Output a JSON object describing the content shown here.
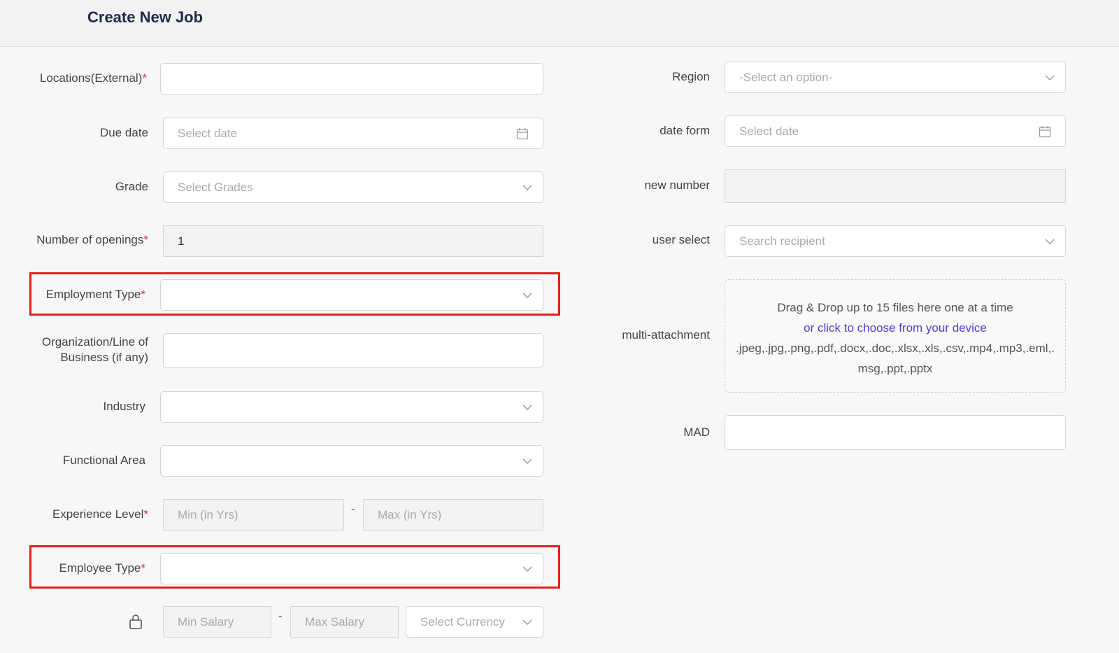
{
  "header": {
    "title": "Create New Job"
  },
  "left": {
    "locations": {
      "label": "Locations(External)",
      "required": "*",
      "value": ""
    },
    "due_date": {
      "label": "Due date",
      "placeholder": "Select date"
    },
    "grade": {
      "label": "Grade",
      "placeholder": "Select Grades"
    },
    "openings": {
      "label": "Number of openings",
      "required": "*",
      "value": "1"
    },
    "employment_type": {
      "label": "Employment Type",
      "required": "*",
      "value": ""
    },
    "organization": {
      "label_line1": "Organization/Line of",
      "label_line2": "Business (if any)",
      "value": ""
    },
    "industry": {
      "label": "Industry",
      "value": ""
    },
    "functional_area": {
      "label": "Functional Area",
      "value": ""
    },
    "experience": {
      "label": "Experience Level",
      "required": "*",
      "min_placeholder": "Min (in Yrs)",
      "max_placeholder": "Max (in Yrs)",
      "separator": "-"
    },
    "employee_type": {
      "label": "Employee Type",
      "required": "*",
      "value": ""
    },
    "salary": {
      "min_placeholder": "Min Salary",
      "max_placeholder": "Max Salary",
      "currency_placeholder": "Select Currency",
      "separator": "-"
    }
  },
  "right": {
    "region": {
      "label": "Region",
      "placeholder": "-Select an option-"
    },
    "date_form": {
      "label": "date form",
      "placeholder": "Select date"
    },
    "new_number": {
      "label": "new number",
      "value": ""
    },
    "user_select": {
      "label": "user select",
      "placeholder": "Search recipient"
    },
    "attachment": {
      "label": "multi-attachment",
      "line1": "Drag & Drop up to 15 files here one at a time",
      "line2": "or click to choose from your device",
      "line3": ".jpeg,.jpg,.png,.pdf,.docx,.doc,.xlsx,.xls,.csv,.mp4,.mp3,.eml,.",
      "line4": "msg,.ppt,.pptx"
    },
    "mad": {
      "label": "MAD",
      "value": ""
    }
  },
  "colors": {
    "required": "#e0283a",
    "link": "#4b3fd6",
    "highlight": "#e3201b"
  }
}
